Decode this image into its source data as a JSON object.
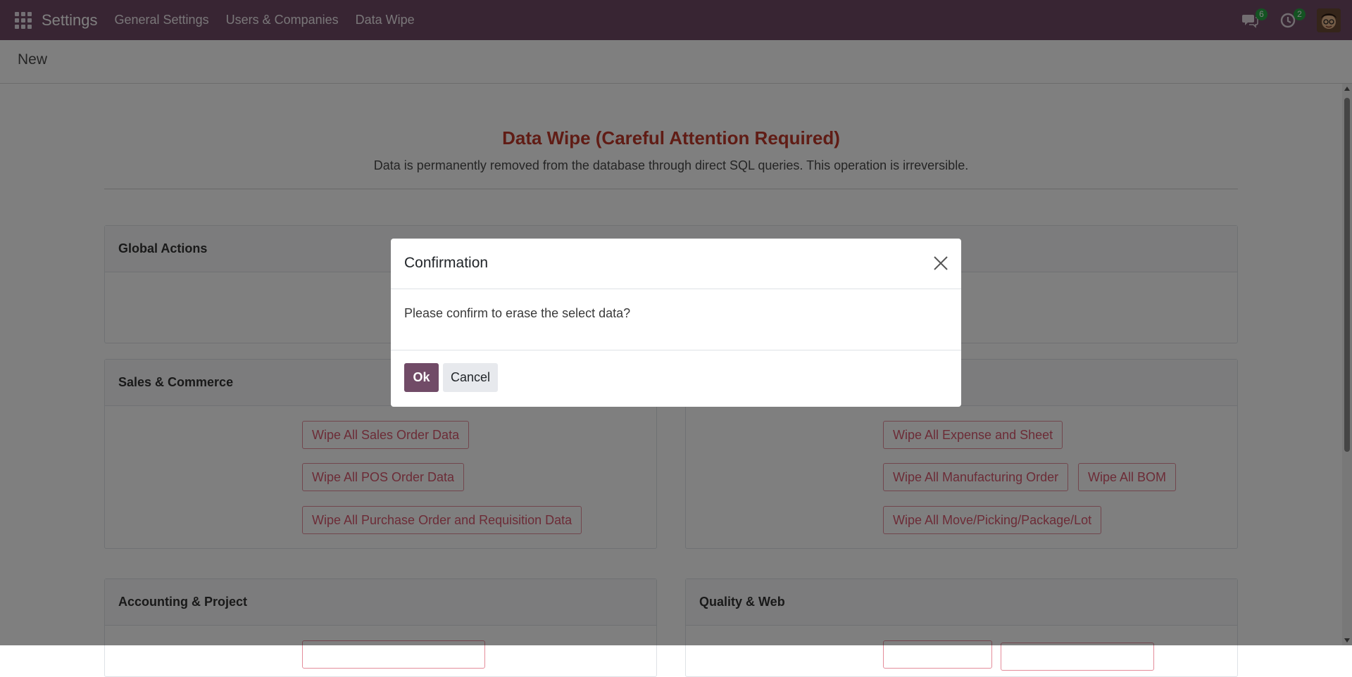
{
  "navbar": {
    "app_name": "Settings",
    "menu": [
      "General Settings",
      "Users & Companies",
      "Data Wipe"
    ],
    "messages_count": "6",
    "activities_count": "2"
  },
  "breadcrumb": "New",
  "page": {
    "title": "Data Wipe (Careful Attention Required)",
    "subtitle": "Data is permanently removed from the database through direct SQL queries. This operation is irreversible."
  },
  "sections": {
    "global": {
      "title": "Global Actions"
    },
    "sales": {
      "title": "Sales & Commerce",
      "buttons": [
        "Wipe All Sales Order Data",
        "Wipe All POS Order Data",
        "Wipe All Purchase Order and Requisition Data"
      ]
    },
    "operations": {
      "buttons": [
        "Wipe All Expense and Sheet",
        "Wipe All Manufacturing Order",
        "Wipe All BOM",
        "Wipe All Move/Picking/Package/Lot"
      ]
    },
    "accounting": {
      "title": "Accounting & Project"
    },
    "quality": {
      "title": "Quality & Web"
    }
  },
  "modal": {
    "title": "Confirmation",
    "message": "Please confirm to erase the select data?",
    "ok_label": "Ok",
    "cancel_label": "Cancel"
  },
  "colors": {
    "brand": "#714b67",
    "danger_title": "#c0392b",
    "wipe_button": "#d9586e"
  }
}
